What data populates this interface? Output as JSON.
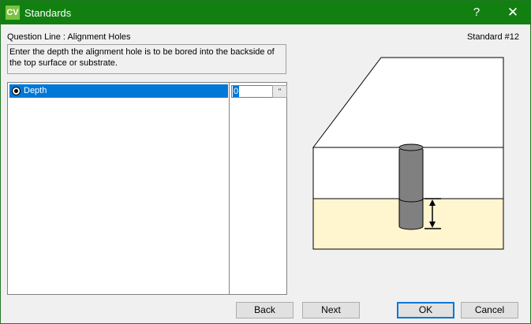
{
  "window": {
    "title": "Standards",
    "app_icon_label": "CV",
    "help_label": "?",
    "close_label": "✕"
  },
  "header": {
    "question_line": "Question Line : Alignment Holes",
    "standard_number": "Standard #12"
  },
  "description": "Enter the depth the alignment hole is to be bored into the backside of the top surface or substrate.",
  "list": {
    "items": [
      {
        "label": "Depth",
        "value": "0",
        "unit": "\""
      }
    ]
  },
  "buttons": {
    "back": "Back",
    "next": "Next",
    "ok": "OK",
    "cancel": "Cancel"
  },
  "colors": {
    "titlebar": "#118011",
    "accent": "#0078d7",
    "substrate": "#fff5cf",
    "hole": "#808080"
  },
  "icons": {
    "help": "question-mark-icon",
    "close": "close-icon",
    "radio": "radio-selected-icon"
  }
}
